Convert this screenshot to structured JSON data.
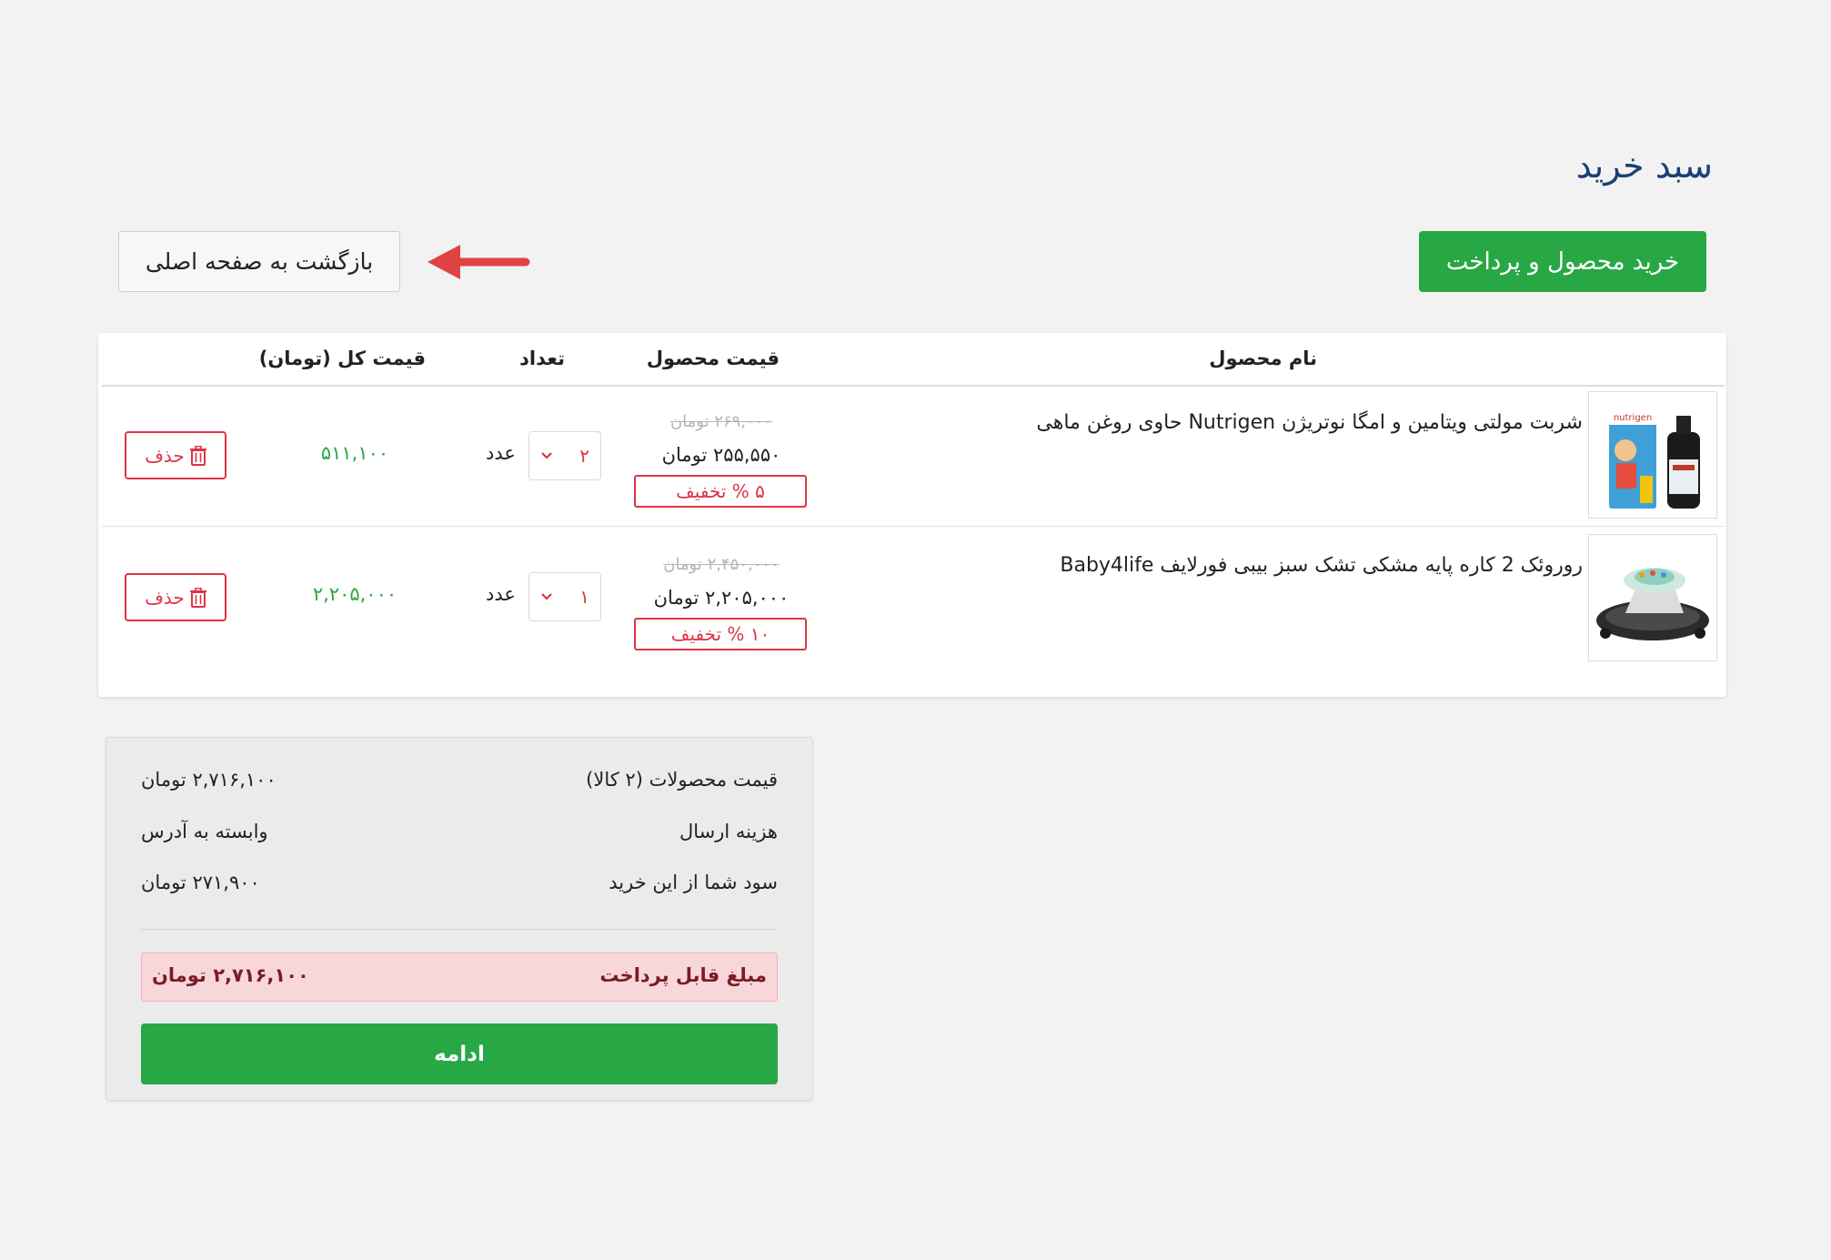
{
  "page": {
    "title": "سبد خرید"
  },
  "actions": {
    "buy_label": "خرید محصول و پرداخت",
    "back_label": "بازگشت به صفحه اصلی"
  },
  "colors": {
    "primary_green": "#28a745",
    "danger_red": "#dc3545",
    "title_blue": "#1c3f75",
    "arrow_red": "#e04343"
  },
  "table": {
    "headers": {
      "name": "نام محصول",
      "price": "قیمت محصول",
      "qty": "تعداد",
      "total": "قیمت کل (تومان)"
    },
    "rows": [
      {
        "name": "شربت مولتی ویتامین و امگا نوتریژن Nutrigen حاوی روغن ماهی",
        "old_price": "۲۶۹,۰۰۰ تومان",
        "new_price": "۲۵۵,۵۵۰ تومان",
        "discount": "۵ % تخفیف",
        "qty": "۲",
        "unit": "عدد",
        "total": "۵۱۱,۱۰۰",
        "delete_label": "حذف",
        "image_icon": "syrup-bottle-image"
      },
      {
        "name": "روروئک 2 کاره پایه مشکی تشک سبز بیبی فورلایف Baby4life",
        "old_price": "۲,۴۵۰,۰۰۰ تومان",
        "new_price": "۲,۲۰۵,۰۰۰ تومان",
        "discount": "۱۰ % تخفیف",
        "qty": "۱",
        "unit": "عدد",
        "total": "۲,۲۰۵,۰۰۰",
        "delete_label": "حذف",
        "image_icon": "baby-walker-image"
      }
    ]
  },
  "summary": {
    "items_label": "قیمت محصولات (۲ کالا)",
    "items_value": "۲,۷۱۶,۱۰۰ تومان",
    "shipping_label": "هزینه ارسال",
    "shipping_value": "وابسته به آدرس",
    "savings_label": "سود شما از این خرید",
    "savings_value": "۲۷۱,۹۰۰ تومان",
    "payable_label": "مبلغ قابل پرداخت",
    "payable_value": "۲,۷۱۶,۱۰۰ تومان",
    "continue_label": "ادامه"
  }
}
